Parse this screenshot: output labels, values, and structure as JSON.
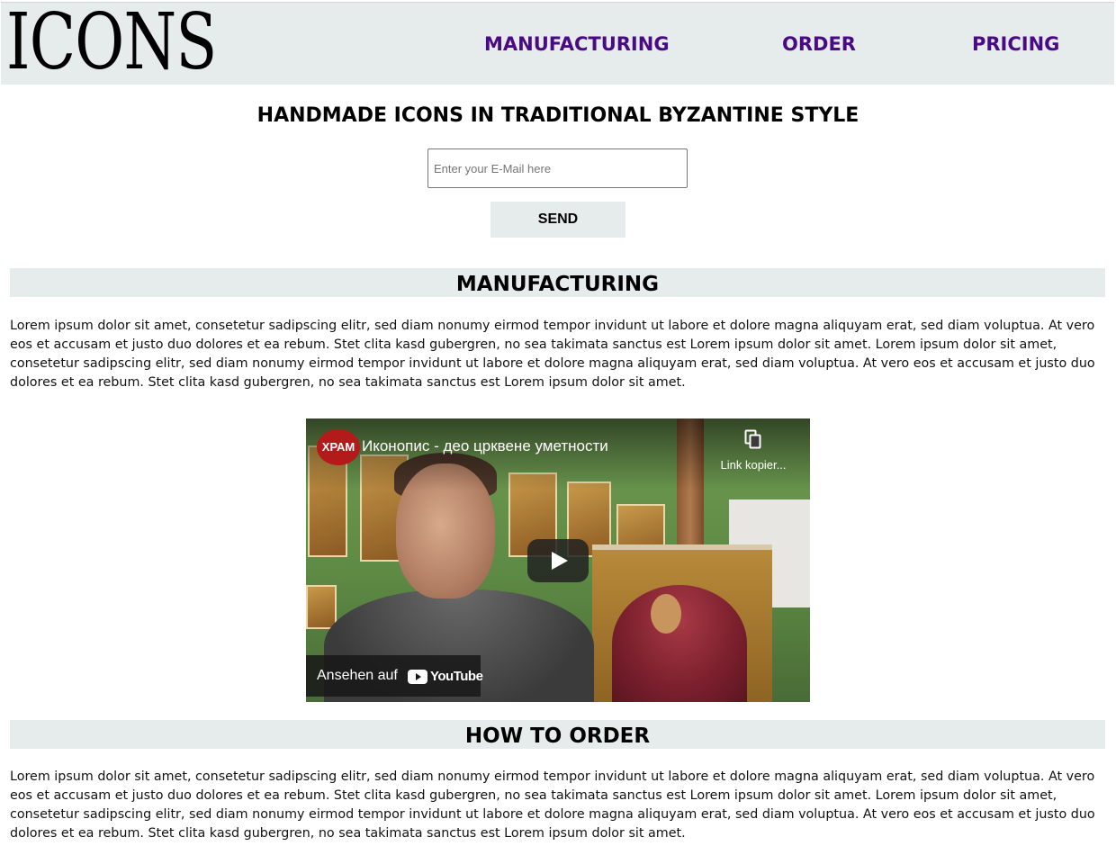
{
  "header": {
    "logo_text": "ICONS",
    "nav": [
      {
        "label": "MANUFACTURING"
      },
      {
        "label": "ORDER"
      },
      {
        "label": "PRICING"
      }
    ]
  },
  "hero": {
    "title": "HANDMADE ICONS IN TRADITIONAL BYZANTINE STYLE",
    "email_placeholder": "Enter your E-Mail here",
    "send_label": "SEND"
  },
  "sections": [
    {
      "heading": "MANUFACTURING",
      "text": "Lorem ipsum dolor sit amet, consetetur sadipscing elitr, sed diam nonumy eirmod tempor invidunt ut labore et dolore magna aliquyam erat, sed diam voluptua. At vero eos et accusam et justo duo dolores et ea rebum. Stet clita kasd gubergren, no sea takimata sanctus est Lorem ipsum dolor sit amet. Lorem ipsum dolor sit amet, consetetur sadipscing elitr, sed diam nonumy eirmod tempor invidunt ut labore et dolore magna aliquyam erat, sed diam voluptua. At vero eos et accusam et justo duo dolores et ea rebum. Stet clita kasd gubergren, no sea takimata sanctus est Lorem ipsum dolor sit amet."
    },
    {
      "heading": "HOW TO ORDER",
      "text": "Lorem ipsum dolor sit amet, consetetur sadipscing elitr, sed diam nonumy eirmod tempor invidunt ut labore et dolore magna aliquyam erat, sed diam voluptua. At vero eos et accusam et justo duo dolores et ea rebum. Stet clita kasd gubergren, no sea takimata sanctus est Lorem ipsum dolor sit amet. Lorem ipsum dolor sit amet, consetetur sadipscing elitr, sed diam nonumy eirmod tempor invidunt ut labore et dolore magna aliquyam erat, sed diam voluptua. At vero eos et accusam et justo duo dolores et ea rebum. Stet clita kasd gubergren, no sea takimata sanctus est Lorem ipsum dolor sit amet."
    }
  ],
  "video": {
    "channel_badge": "ХРАМ",
    "title": "Иконопис - део црквене уметности",
    "copy_link_label": "Link kopier...",
    "watch_on_label": "Ansehen auf",
    "youtube_label": "YouTube"
  },
  "colors": {
    "header_bg": "#e5eceb",
    "nav_link": "#4b0a85",
    "section_bar": "#e5eceb"
  }
}
